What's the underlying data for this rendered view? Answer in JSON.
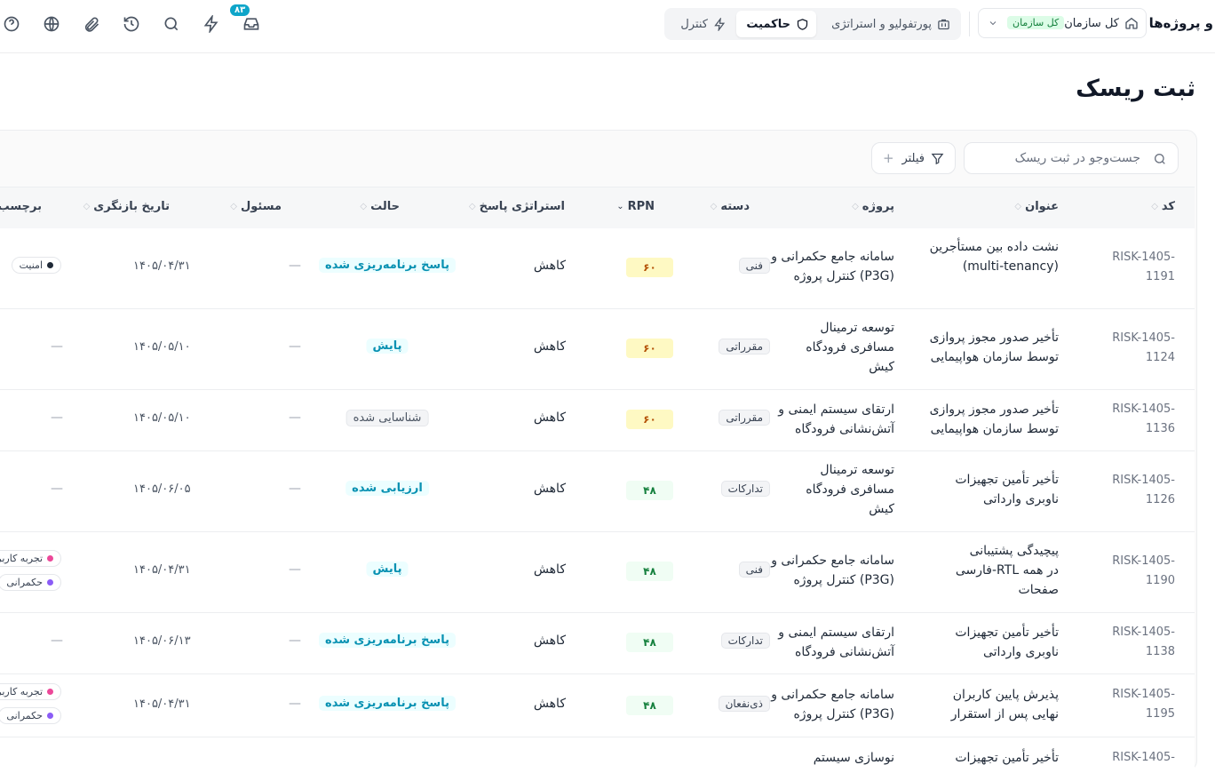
{
  "header": {
    "brand": "و پروژه‌ها",
    "org_label": "کل سازمان",
    "org_badge": "کل سازمان",
    "tabs": [
      {
        "label": "پورتفولیو و استراتژی",
        "icon": "portfolio-icon"
      },
      {
        "label": "حاکمیت",
        "icon": "shield-icon",
        "active": true
      },
      {
        "label": "کنترل",
        "icon": "bolt-icon"
      }
    ],
    "notification_count": "۸۳",
    "tools": [
      "inbox-icon",
      "lightning-icon",
      "search-icon",
      "history-icon",
      "attachment-icon",
      "globe-icon",
      "help-icon"
    ]
  },
  "page": {
    "title": "ثبت ریسک",
    "search_placeholder": "جست‌وجو در ثبت ریسک",
    "filter_label": "فیلتر",
    "filter_plus": "+"
  },
  "table": {
    "headers": {
      "code": "کد",
      "title": "عنوان",
      "project": "پروژه",
      "category": "دسته",
      "rpn": "RPN",
      "strategy": "استراتژی پاسخ",
      "status": "حالت",
      "owner": "مسئول",
      "review_date": "تاریخ بازنگری",
      "tags": "برچسب‌ها"
    },
    "rows": [
      {
        "code": "RISK-1405-1191",
        "title": "نشت داده بین مستأجرین (multi-tenancy)",
        "project": "سامانه جامع حکمرانی و کنترل پروژه (P3G)",
        "category": "فنی",
        "rpn": "۶۰",
        "strategy": "کاهش",
        "status": "پاسخ برنامه‌ریزی شده",
        "owner": "—",
        "review_date": "۱۴۰۵/۰۴/۳۱",
        "tags": [
          "امنیت"
        ]
      },
      {
        "code": "RISK-1405-1124",
        "title": "تأخیر صدور مجوز پروازی توسط سازمان هواپیمایی",
        "project": "توسعه ترمینال مسافری فرودگاه کیش",
        "category": "مقرراتی",
        "rpn": "۶۰",
        "strategy": "کاهش",
        "status": "پایش",
        "owner": "—",
        "review_date": "۱۴۰۵/۰۵/۱۰",
        "tags_none": "—"
      },
      {
        "code": "RISK-1405-1136",
        "title": "تأخیر صدور مجوز پروازی توسط سازمان هواپیمایی",
        "project": "ارتقای سیستم ایمنی و آتش‌نشانی فرودگاه",
        "category": "مقرراتی",
        "rpn": "۶۰",
        "strategy": "کاهش",
        "status": "شناسایی شده",
        "owner": "—",
        "review_date": "۱۴۰۵/۰۵/۱۰",
        "tags_none": "—"
      },
      {
        "code": "RISK-1405-1126",
        "title": "تأخیر تأمین تجهیزات ناوبری وارداتی",
        "project": "توسعه ترمینال مسافری فرودگاه کیش",
        "category": "تدارکات",
        "rpn": "۴۸",
        "strategy": "کاهش",
        "status": "ارزیابی شده",
        "owner": "—",
        "review_date": "۱۴۰۵/۰۶/۰۵",
        "tags_none": "—"
      },
      {
        "code": "RISK-1405-1190",
        "title": "پیچیدگی پشتیبانی فارسی-RTL در همه صفحات",
        "project": "سامانه جامع حکمرانی و کنترل پروژه (P3G)",
        "category": "فنی",
        "rpn": "۴۸",
        "strategy": "کاهش",
        "status": "پایش",
        "owner": "—",
        "review_date": "۱۴۰۵/۰۴/۳۱",
        "tags": [
          "تجربه کاربری",
          "حکمرانی"
        ]
      },
      {
        "code": "RISK-1405-1138",
        "title": "تأخیر تأمین تجهیزات ناوبری وارداتی",
        "project": "ارتقای سیستم ایمنی و آتش‌نشانی فرودگاه",
        "category": "تدارکات",
        "rpn": "۴۸",
        "strategy": "کاهش",
        "status": "پاسخ برنامه‌ریزی شده",
        "owner": "—",
        "review_date": "۱۴۰۵/۰۶/۱۳",
        "tags_none": "—"
      },
      {
        "code": "RISK-1405-1195",
        "title": "پذیرش پایین کاربران نهایی پس از استقرار",
        "project": "سامانه جامع حکمرانی و کنترل پروژه (P3G)",
        "category": "ذی‌نفعان",
        "rpn": "۴۸",
        "strategy": "کاهش",
        "status": "پاسخ برنامه‌ریزی شده",
        "owner": "—",
        "review_date": "۱۴۰۵/۰۴/۳۱",
        "tags": [
          "تجربه کاربری",
          "حکمرانی"
        ]
      },
      {
        "code": "RISK-1405-",
        "title": "تأخیر تأمین تجهیزات",
        "project": "نوسازی سیستم"
      }
    ]
  },
  "colors": {
    "accent": "#0ea5c9",
    "teal_status": "#0891b2",
    "rpn_amber": "#b45309",
    "rpn_green": "#15803d",
    "tag_security_dot": "#1f2937",
    "tag_ux_dot": "#ec4899",
    "tag_governance_dot": "#8b5cf6"
  }
}
